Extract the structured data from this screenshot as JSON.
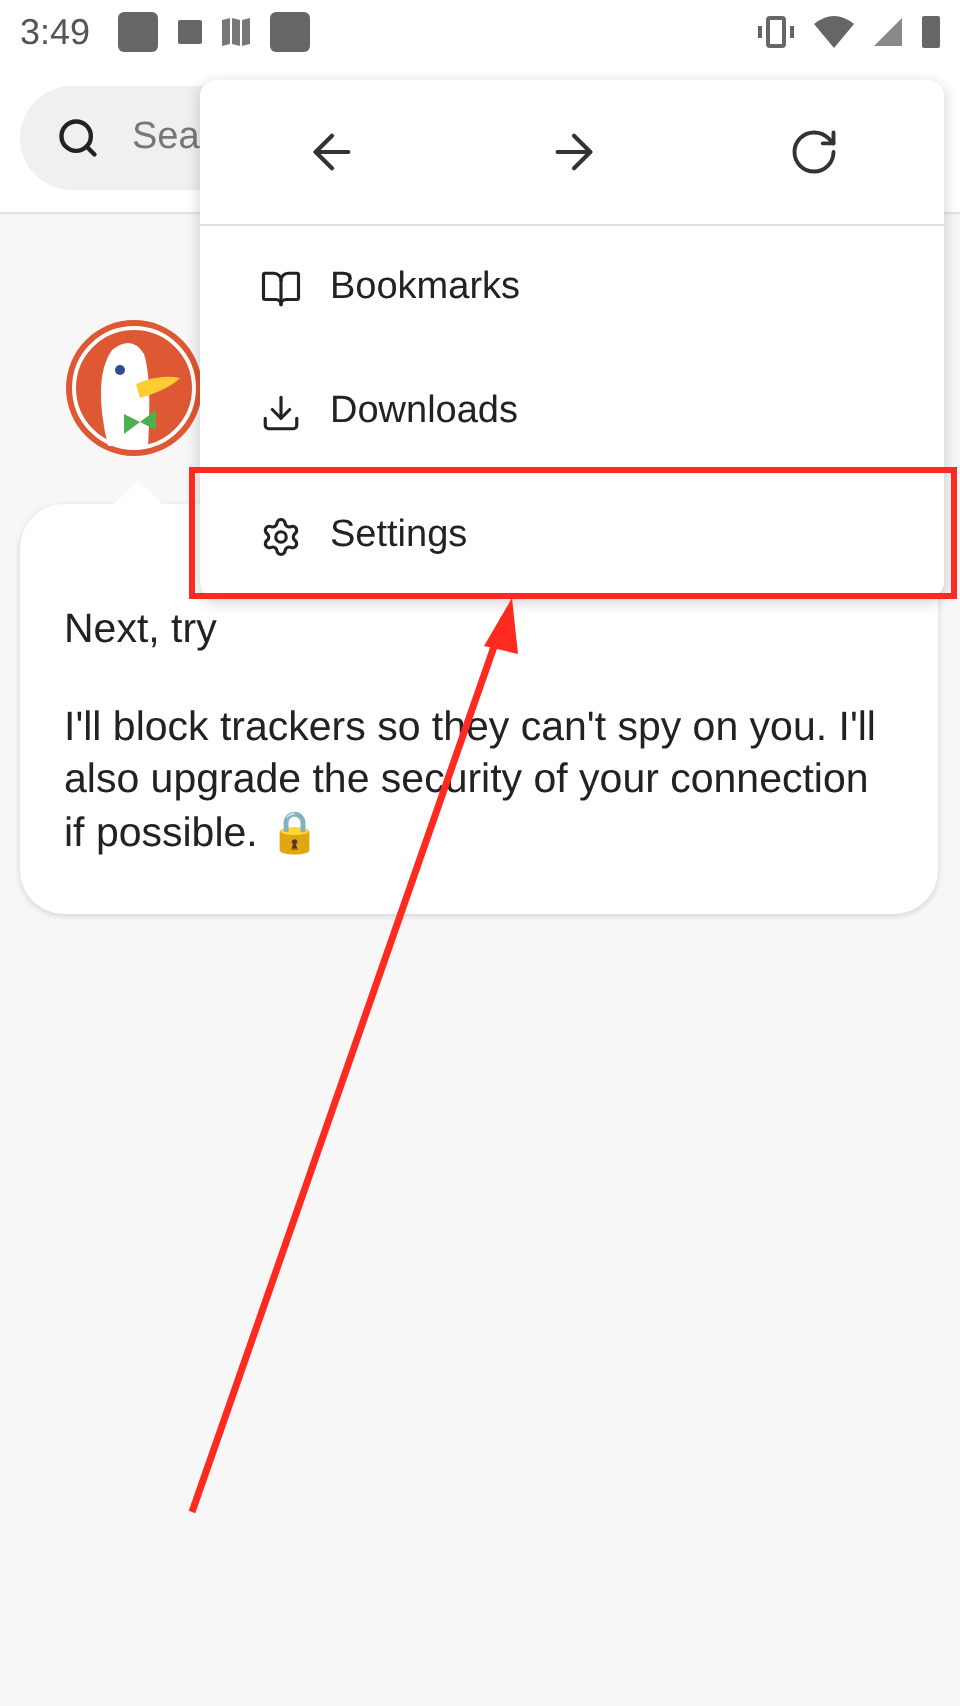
{
  "status_bar": {
    "time": "3:49"
  },
  "search": {
    "placeholder": "Sea"
  },
  "message": {
    "paragraphs": [
      "Next, try",
      "I'll block trackers so they can't spy on you. I'll also upgrade the security of your connection if possible. 🔒"
    ]
  },
  "menu": {
    "nav": [
      {
        "kind": "back"
      },
      {
        "kind": "forward"
      },
      {
        "kind": "reload"
      }
    ],
    "items": [
      {
        "kind": "bookmarks",
        "label": "Bookmarks",
        "highlighted": false
      },
      {
        "kind": "downloads",
        "label": "Downloads",
        "highlighted": false
      },
      {
        "kind": "settings",
        "label": "Settings",
        "highlighted": true
      }
    ]
  }
}
